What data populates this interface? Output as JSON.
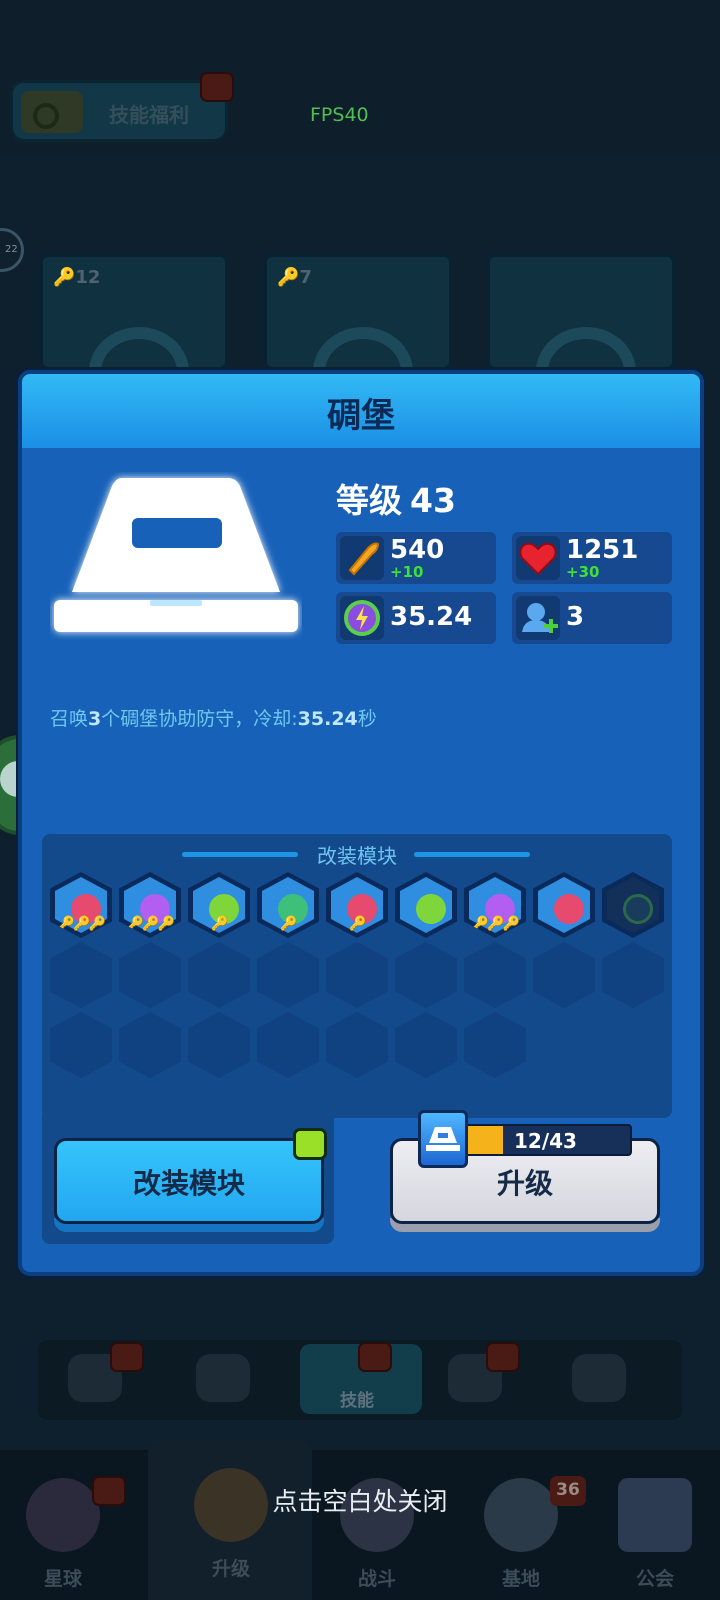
{
  "top": {
    "skill_welfare_label": "技能福利",
    "fps": "FPS40",
    "side_badge": "22"
  },
  "bg_cards": [
    {
      "count": "🔑12"
    },
    {
      "count": "🔑7"
    },
    {
      "count": ""
    }
  ],
  "tabs": {
    "active_label": "技能"
  },
  "nav": {
    "items": [
      "星球",
      "升级",
      "战斗",
      "基地",
      "公会"
    ],
    "base_badge": "36"
  },
  "close_hint": "点击空白处关闭",
  "modal": {
    "title": "碉堡",
    "level_label": "等级",
    "level_value": "43",
    "stats": {
      "attack": {
        "value": "540",
        "bonus": "+10",
        "icon": "bullet-icon",
        "color": "#f5a623"
      },
      "health": {
        "value": "1251",
        "bonus": "+30",
        "icon": "heart-icon",
        "color": "#e8232f"
      },
      "cooldown": {
        "value": "35.24",
        "icon": "energy-cycle-icon",
        "color": "#8b4ce0"
      },
      "summon": {
        "value": "3",
        "icon": "unit-add-icon",
        "color": "#5aa8f0"
      }
    },
    "description": {
      "prefix": "召唤",
      "count": "3",
      "middle": "个碉堡协助防守，冷却:",
      "cooldown": "35.24",
      "suffix": "秒"
    },
    "modules": {
      "title": "改装模块",
      "slots": [
        {
          "icon": "rocket-icon",
          "color": "#e64a6e",
          "stars": 3
        },
        {
          "icon": "tank-plus-icon",
          "color": "#b25ef0",
          "stars": 3
        },
        {
          "icon": "heart-gem-icon",
          "color": "#7fd63a",
          "stars": 1
        },
        {
          "icon": "lightning-cycle-icon",
          "color": "#3ec07a",
          "stars": 1
        },
        {
          "icon": "rocket-icon",
          "color": "#e64a6e",
          "stars": 1
        },
        {
          "icon": "heart-gem-icon",
          "color": "#7fd63a",
          "stars": 0
        },
        {
          "icon": "tank-plus-icon",
          "color": "#b25ef0",
          "stars": 3
        },
        {
          "icon": "rocket-icon",
          "color": "#e64a6e",
          "stars": 0
        },
        {
          "icon": "lightning-locked-icon",
          "color": "#1a3c5c",
          "stars": 0
        }
      ]
    },
    "buttons": {
      "modify": "改装模块",
      "upgrade": "升级"
    },
    "upgrade_progress": {
      "text": "12/43",
      "fraction": 0.279
    }
  }
}
